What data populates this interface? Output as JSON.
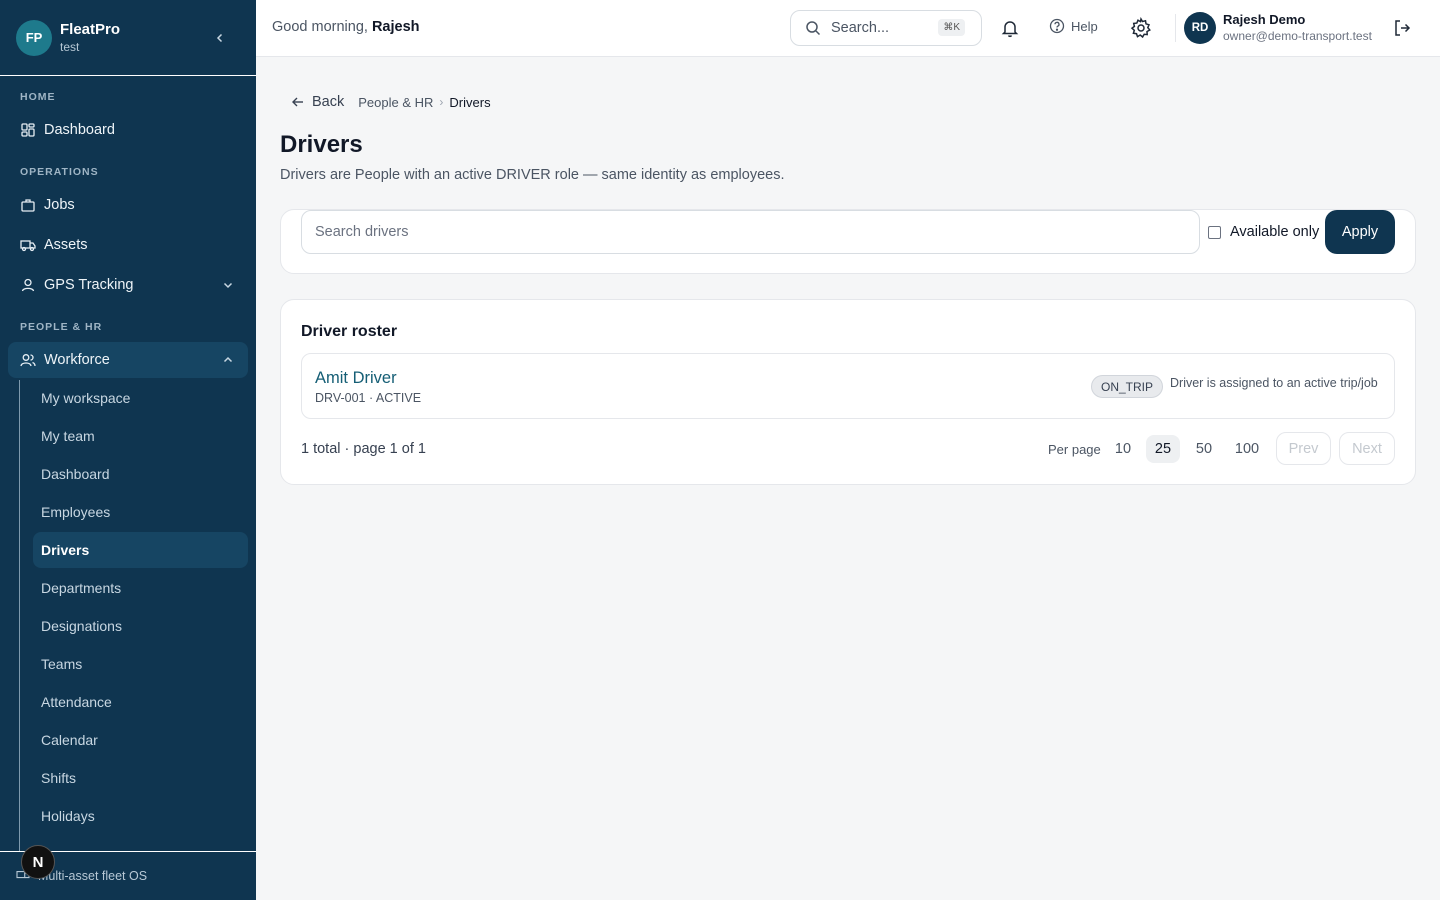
{
  "brand": {
    "initials": "FP",
    "name": "FleatPro",
    "sub": "test"
  },
  "sidebar": {
    "sections": {
      "home": "HOME",
      "operations": "OPERATIONS",
      "people": "PEOPLE & HR"
    },
    "items": [
      {
        "label": "Dashboard",
        "icon": "dashboard-icon"
      },
      {
        "label": "Jobs",
        "icon": "briefcase-icon"
      },
      {
        "label": "Assets",
        "icon": "truck-icon"
      },
      {
        "label": "GPS Tracking",
        "icon": "person-pin-icon"
      },
      {
        "label": "Workforce",
        "icon": "users-icon"
      }
    ],
    "sub_items": [
      "My workspace",
      "My team",
      "Dashboard",
      "Employees",
      "Drivers",
      "Departments",
      "Designations",
      "Teams",
      "Attendance",
      "Calendar",
      "Shifts",
      "Holidays"
    ],
    "footer": "Multi-asset fleet OS",
    "badge": "N"
  },
  "header": {
    "greeting": "Good morning,",
    "greeting_name": "Rajesh",
    "search_placeholder": "Search...",
    "search_shortcut": "⌘K",
    "help_label": "Help",
    "user_initials": "RD",
    "user_name": "Rajesh Demo",
    "user_email": "owner@demo-transport.test"
  },
  "breadcrumb": {
    "back": "Back",
    "parent": "People & HR",
    "current": "Drivers"
  },
  "page": {
    "title": "Drivers",
    "description": "Drivers are People with an active DRIVER role — same identity as employees."
  },
  "filters": {
    "search_placeholder": "Search drivers",
    "available_only": "Available only",
    "available_checked": false,
    "apply_label": "Apply"
  },
  "roster": {
    "title": "Driver roster",
    "drivers": [
      {
        "name": "Amit Driver",
        "meta": "DRV-001 · ACTIVE",
        "status": "ON_TRIP",
        "status_desc": "Driver is assigned to an active trip/job"
      }
    ],
    "total_text": "1 total · page 1 of 1",
    "per_page_label": "Per page",
    "per_page_options": [
      "10",
      "25",
      "50",
      "100"
    ],
    "per_page_selected": "25",
    "prev_label": "Prev",
    "next_label": "Next"
  }
}
